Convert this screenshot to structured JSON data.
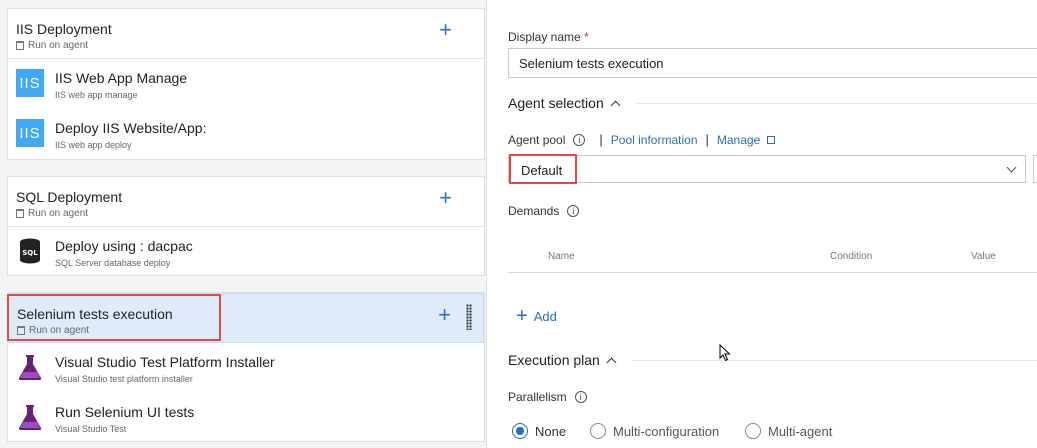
{
  "phases": [
    {
      "title": "IIS Deployment",
      "subtitle": "Run on agent",
      "tasks": [
        {
          "name": "IIS Web App Manage",
          "description": "IIS web app manage",
          "icon": "iis-icon"
        },
        {
          "name": "Deploy IIS Website/App:",
          "description": "IIS web app deploy",
          "icon": "iis-icon"
        }
      ]
    },
    {
      "title": "SQL Deployment",
      "subtitle": "Run on agent",
      "tasks": [
        {
          "name": "Deploy using : dacpac",
          "description": "SQL Server database deploy",
          "icon": "sql-icon"
        }
      ]
    },
    {
      "title": "Selenium tests execution",
      "subtitle": "Run on agent",
      "selected": true,
      "tasks": [
        {
          "name": "Visual Studio Test Platform Installer",
          "description": "Visual Studio test platform installer",
          "icon": "flask-icon"
        },
        {
          "name": "Run Selenium UI tests",
          "description": "Visual Studio Test",
          "icon": "flask-icon"
        }
      ]
    }
  ],
  "icon_labels": {
    "iis": "IIS",
    "sql": "SQL",
    "plus": "+"
  },
  "details": {
    "display_name_label": "Display name",
    "required_mark": "*",
    "display_name_value": "Selenium tests execution",
    "agent_selection_label": "Agent selection",
    "agent_pool_label": "Agent pool",
    "info_glyph": "i",
    "pool_information_link": "Pool information",
    "manage_link": "Manage",
    "separator": "|",
    "agent_pool_value": "Default",
    "demands_label": "Demands",
    "demands_columns": [
      "Name",
      "Condition",
      "Value"
    ],
    "add_label": "Add",
    "execution_plan_label": "Execution plan",
    "parallelism_label": "Parallelism",
    "parallelism_options": [
      "None",
      "Multi-configuration",
      "Multi-agent"
    ],
    "parallelism_selected": "None"
  },
  "colors": {
    "accent": "#2a74c7",
    "highlight": "#e04a4a",
    "selected_bg": "#deecf9",
    "iis_blue": "#3fa9f5",
    "flask_purple": "#68217a"
  }
}
